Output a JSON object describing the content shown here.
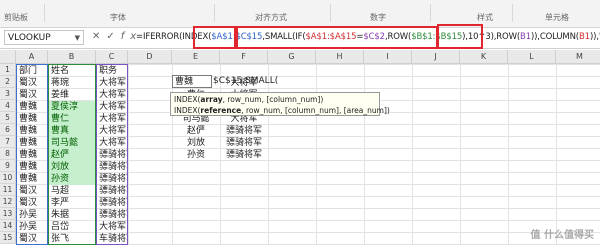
{
  "ribbon": {
    "groups": [
      "剪贴板",
      "字体",
      "对齐方式",
      "数字",
      "样式",
      "单元格"
    ]
  },
  "formula_bar": {
    "name_box": "VLOOKUP",
    "cancel_icon": "✕",
    "enter_icon": "✓",
    "fx_icon": "fx",
    "segments": [
      {
        "text": "=IFERROR(INDEX(",
        "color": "default"
      },
      {
        "text": "$A$1:$C$15",
        "color": "blue"
      },
      {
        "text": ",SMALL(IF(",
        "color": "default"
      },
      {
        "text": "$A$1:$A$15",
        "color": "red"
      },
      {
        "text": "=",
        "color": "default"
      },
      {
        "text": "$C$2",
        "color": "purple"
      },
      {
        "text": ",ROW(",
        "color": "default"
      },
      {
        "text": "$B$1:$B$15",
        "color": "green"
      },
      {
        "text": "),10^3),ROW(",
        "color": "default"
      },
      {
        "text": "B1",
        "color": "purple"
      },
      {
        "text": ")),COLUMN(",
        "color": "default"
      },
      {
        "text": "B1",
        "color": "red"
      },
      {
        "text": ")),\"\")",
        "color": "default"
      }
    ]
  },
  "columns": [
    "A",
    "B",
    "C",
    "D",
    "E",
    "F",
    "G",
    "H",
    "I",
    "J",
    "K",
    "L",
    "M"
  ],
  "rows": [
    "1",
    "2",
    "3",
    "4",
    "5",
    "6",
    "7",
    "8",
    "9",
    "10",
    "11",
    "12",
    "13",
    "14",
    "15"
  ],
  "table": [
    [
      "部门",
      "姓名",
      "职务"
    ],
    [
      "蜀汉",
      "蒋琬",
      "大将军"
    ],
    [
      "蜀汉",
      "姜维",
      "大将军"
    ],
    [
      "曹魏",
      "夏侯淳",
      "大将军"
    ],
    [
      "曹魏",
      "曹仁",
      "大将军"
    ],
    [
      "曹魏",
      "曹真",
      "大将军"
    ],
    [
      "曹魏",
      "司马懿",
      "大将军"
    ],
    [
      "曹魏",
      "赵俨",
      "骠骑将军"
    ],
    [
      "曹魏",
      "刘放",
      "骠骑将军"
    ],
    [
      "曹魏",
      "孙资",
      "骠骑将军"
    ],
    [
      "蜀汉",
      "马超",
      "骠骑将军"
    ],
    [
      "蜀汉",
      "李严",
      "骠骑将军"
    ],
    [
      "孙吴",
      "朱据",
      "骠骑将军"
    ],
    [
      "孙吴",
      "吕岱",
      "大将军"
    ],
    [
      "蜀汉",
      "张飞",
      "车骑将军"
    ]
  ],
  "lookup": {
    "key": "曹魏",
    "editing_text": "$C$15,SMALL(",
    "e_values": [
      "曹仁",
      "曹真",
      "司马懿",
      "赵俨",
      "刘放",
      "孙资"
    ],
    "f_values": [
      "大将军",
      "大将军",
      "大将军",
      "大将军",
      "骠骑将军",
      "骠骑将军",
      "骠骑将军"
    ]
  },
  "tooltip": {
    "line1_prefix": "INDEX(",
    "line1_bold": "array",
    "line1_rest": ", row_num, [column_num])",
    "line2_prefix": "INDEX(",
    "line2_bold": "reference",
    "line2_rest": ", row_num, [column_num], [area_num])"
  },
  "watermark": "值 什么值得买"
}
